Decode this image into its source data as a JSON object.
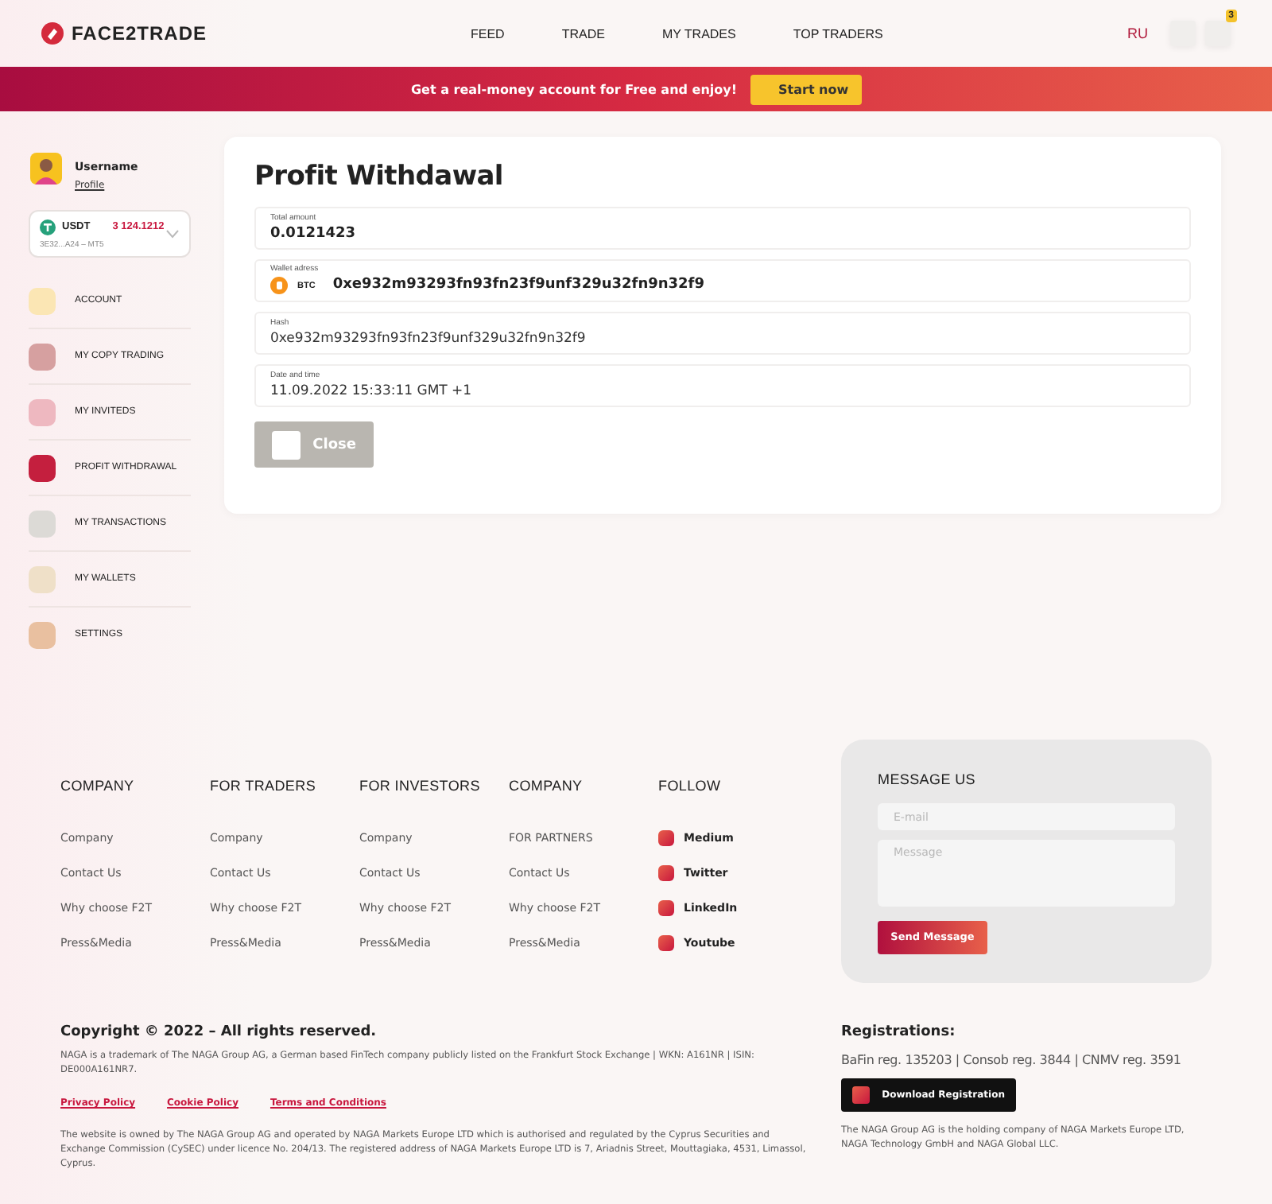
{
  "header": {
    "logo": "FACE2TRADE",
    "nav": [
      {
        "label": "FEED"
      },
      {
        "label": "TRADE"
      },
      {
        "label": "MY TRADES"
      },
      {
        "label": "TOP TRADERS"
      }
    ],
    "language": {
      "label": "RU",
      "selected": true
    },
    "notification_count": "3"
  },
  "promo": {
    "text": "Get a real-money account for Free and enjoy!",
    "button": "Start now"
  },
  "user": {
    "name": "Username",
    "profile_link": "Profile"
  },
  "wallet": {
    "currency": "USDT",
    "balance": "3 124.1212",
    "account": "3E32...A24 – MT5"
  },
  "sidebar": {
    "items": [
      {
        "label": "ACCOUNT",
        "color": "#fbe6b4"
      },
      {
        "label": "MY COPY TRADING",
        "color": "#d6a0a0"
      },
      {
        "label": "MY INVITEDS",
        "color": "#eeb8c0"
      },
      {
        "label": "PROFIT WITHDRAWAL",
        "color": "#c41f3e"
      },
      {
        "label": "MY TRANSACTIONS",
        "color": "#dcdad6"
      },
      {
        "label": "MY WALLETS",
        "color": "#efe0c8"
      },
      {
        "label": "SETTINGS",
        "color": "#e9c0a0"
      }
    ]
  },
  "withdrawal": {
    "title": "Profit Withdawal",
    "fields": [
      {
        "kind": "amount",
        "label": "Total amount",
        "value": "0.0121423"
      },
      {
        "kind": "wallet",
        "label": "Wallet adress",
        "coin": "BTC",
        "value": "0xe932m93293fn93fn23f9unf329u32fn9n32f9"
      },
      {
        "kind": "plain",
        "label": "Hash",
        "value": "0xe932m93293fn93fn23f9unf329u32fn9n32f9"
      },
      {
        "kind": "plain",
        "label": "Date and time",
        "value": "11.09.2022 15:33:11 GMT +1"
      }
    ],
    "close_button": "Close",
    "close_disabled": true
  },
  "footer": {
    "columns": [
      {
        "kind": "links",
        "heading": "COMPANY",
        "links": [
          "Company",
          "Contact Us",
          "Why choose F2T",
          "Press&Media"
        ]
      },
      {
        "kind": "links",
        "heading": "FOR TRADERS",
        "links": [
          "Company",
          "Contact Us",
          "Why choose F2T",
          "Press&Media"
        ]
      },
      {
        "kind": "links",
        "heading": "FOR INVESTORS",
        "links": [
          "Company",
          "Contact Us",
          "Why choose F2T",
          "Press&Media"
        ]
      },
      {
        "kind": "links",
        "heading": "COMPANY",
        "links": [
          "FOR PARTNERS",
          "Contact Us",
          "Why choose F2T",
          "Press&Media"
        ]
      },
      {
        "kind": "social",
        "heading": "FOLLOW",
        "links": [
          "Medium",
          "Twitter",
          "LinkedIn",
          "Youtube"
        ]
      }
    ],
    "message_form": {
      "heading": "MESSAGE US",
      "email_placeholder": "E-mail",
      "message_placeholder": "Message",
      "button": "Send Message"
    },
    "copyright": "Copyright © 2022 – All rights reserved.",
    "trademark": "NAGA is a trademark of The NAGA Group AG, a German based FinTech company publicly listed on the Frankfurt Stock Exchange | WKN: A161NR | ISIN: DE000A161NR7.",
    "legal_links": [
      "Privacy Policy",
      "Cookie Policy",
      "Terms and Conditions"
    ],
    "disclaimer": "The website is owned by The NAGA Group AG and operated by NAGA Markets Europe LTD which is authorised and regulated by the Cyprus Securities and Exchange Commission (CySEC) under licence No. 204/13. The registered address of NAGA Markets Europe LTD is 7, Ariadnis Street, Mouttagiaka, 4531, Limassol, Cyprus.",
    "registrations": {
      "heading": "Registrations:",
      "text": "BaFin reg. 135203 | Consob reg. 3844 | CNMV reg. 3591",
      "button": "Download Registration",
      "note": "The NAGA Group AG is the holding company of NAGA Markets Europe LTD, NAGA Technology GmbH and NAGA Global LLC."
    }
  }
}
